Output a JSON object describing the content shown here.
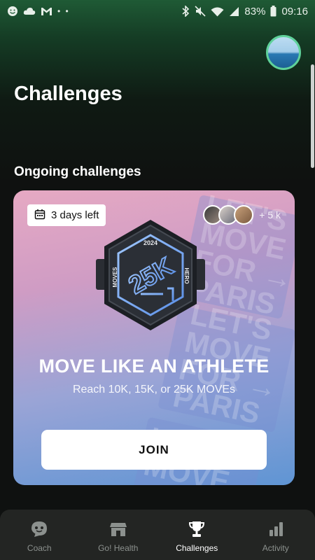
{
  "status_bar": {
    "battery": "83%",
    "time": "09:16",
    "left_icons": [
      "smiley-icon",
      "cloud-icon",
      "gmail-icon",
      "more-dots-icon"
    ],
    "right_icons": [
      "bluetooth-icon",
      "mute-icon",
      "wifi-icon",
      "signal-icon",
      "battery-icon"
    ]
  },
  "header": {
    "title": "Challenges"
  },
  "ongoing": {
    "section_title": "Ongoing challenges",
    "card": {
      "days_left": "3 days left",
      "participants_count": "+ 5 k",
      "badge": {
        "year": "2024",
        "value": "25K",
        "left_label": "MOVES",
        "right_label": "HERO"
      },
      "background_text": [
        "LET'S\nMOVE\nFOR →\nPARIS",
        "LET'S\nMOVE\nFOR →\nPARIS",
        "LET'S\nMOVE"
      ],
      "headline": "MOVE LIKE AN ATHLETE",
      "subtitle": "Reach 10K, 15K, or 25K MOVEs",
      "join_label": "JOIN"
    }
  },
  "bottom_nav": {
    "items": [
      {
        "label": "Coach",
        "icon": "coach-chat-icon",
        "active": false
      },
      {
        "label": "Go! Health",
        "icon": "store-icon",
        "active": false
      },
      {
        "label": "Challenges",
        "icon": "trophy-icon",
        "active": true
      },
      {
        "label": "Activity",
        "icon": "bar-chart-icon",
        "active": false
      }
    ]
  },
  "colors": {
    "accent_green": "#5fd19a",
    "header_green": "#1f5a35",
    "nav_bg": "#232523"
  }
}
